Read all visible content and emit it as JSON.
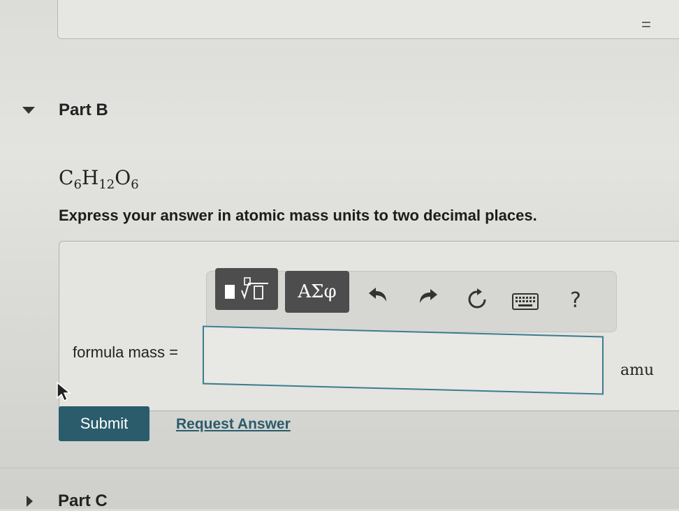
{
  "previous_part": {
    "equals_sign": "="
  },
  "part_b": {
    "title": "Part B",
    "formula": {
      "c": "C",
      "c_sub": "6",
      "h": "H",
      "h_sub": "12",
      "o": "O",
      "o_sub": "6"
    },
    "instruction": "Express your answer in atomic mass units to two decimal places.",
    "toolbar": {
      "greek_label": "ΑΣφ",
      "help_label": "?"
    },
    "input_label": "formula mass =",
    "input_value": "",
    "unit": "amu",
    "submit_label": "Submit",
    "request_label": "Request Answer"
  },
  "part_c": {
    "title": "Part C"
  },
  "colors": {
    "accent": "#2a5c6b",
    "input_border": "#3a7d8c",
    "toolbar_button": "#4d4d4d"
  }
}
